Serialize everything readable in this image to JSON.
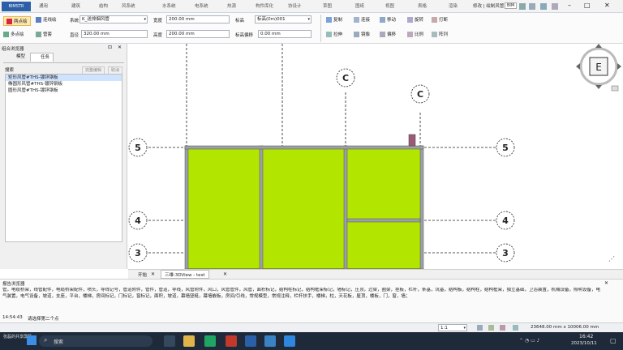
{
  "app": {
    "logo_text": "BIMSTR"
  },
  "ribbon_tabs": [
    "通用",
    "建筑",
    "结构",
    "风系统",
    "水系统",
    "电系统",
    "热源",
    "构件库化",
    "协设计",
    "草图",
    "图纸",
    "视图",
    "表格",
    "渲染"
  ],
  "ribbon_right": {
    "title": "修改 | 绘制风管",
    "bim_badge": "BIM"
  },
  "ribbon": {
    "tools_col1": [
      "两点绘",
      "多点绘"
    ],
    "tools_col2": [
      "连线绘",
      "管套"
    ],
    "system_label": "系统",
    "system_value": "K_送排烟风管",
    "diameter_label": "直径",
    "diameter_value": "320.00 mm",
    "width_label": "宽度",
    "width_value": "200.00 mm",
    "height_label": "高度",
    "height_value": "200.00 mm",
    "elevation_label": "标高",
    "elevation_value": "标高(0m)001",
    "offset_label": "标高偏移",
    "offset_value": "0.00 mm",
    "edit_row1": [
      "复制",
      "连接",
      "移动",
      "旋转",
      "打断"
    ],
    "edit_row2": [
      "拉伸",
      "镜像",
      "偏移",
      "比例",
      "阵列"
    ]
  },
  "left_panel": {
    "title": "组合浏览器",
    "tabs": [
      "模型",
      "任务"
    ],
    "buttons": [
      "完整编辑",
      "取消"
    ],
    "list_header": "搜索",
    "items": [
      "矩形风管#THS-镀锌钢板",
      "椭圆形风管#THS-镀锌钢板",
      "圆形风管#THS-镀锌钢板"
    ]
  },
  "canvas": {
    "grid_labels": {
      "c": "C",
      "c2": "C",
      "five": "5",
      "four": "4",
      "three": "3"
    },
    "nav_cube_face": "E"
  },
  "doc_tabs": [
    "开始",
    "三维:3DView - test"
  ],
  "report": {
    "title": "报告浏览器",
    "text": "管，电缆桥架，线管配件，电缆桥架配件，喷头，导线记号，管道附件，管件，管道，导线，风管附件，风口，风管管件，风管，面积标记，结构柱标记，结构框架标记，墙标记，压顶，过梁，圈梁，挂板，栏杆，条基，坑基，结构板，结构柱，结构框架，独立基础，卫浴装置，机械设备，照明设备，电气装置，电气设备，坡道，支座，平台，楼梯，房间标记，门标记，窗标记，面积，坡道，幕墙竖梃，幕墙嵌板，房间/引线，常规模型，常规注释，栏杆扶手，楼梯，柱，天花板，屋顶，楼板，门，窗，墙；",
    "log_time": "14:54:43",
    "log_msg": "请选择第二个点"
  },
  "status": {
    "scale": "1:1",
    "coords": "23648.00 mm x 10006.00 mm"
  },
  "taskbar": {
    "search": "搜索",
    "user": "张磊的共享屏幕",
    "time": "16:42",
    "date": "2023/10/11"
  },
  "colors": {
    "slab": "#b2e600",
    "accent": "#2b5fa8",
    "taskbar": "#1e2a3a"
  }
}
